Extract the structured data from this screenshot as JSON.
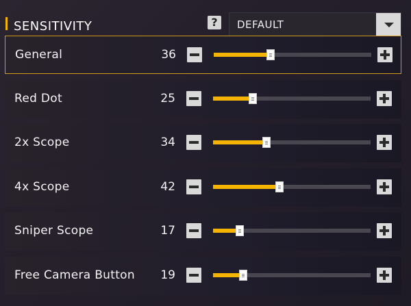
{
  "header": {
    "title": "SENSITIVITY",
    "help_glyph": "?",
    "preset": {
      "selected": "DEFAULT"
    }
  },
  "accent_color": "#f5b400",
  "slider_max": 100,
  "rows": [
    {
      "label": "General",
      "value": "36",
      "selected": true
    },
    {
      "label": "Red Dot",
      "value": "25",
      "selected": false
    },
    {
      "label": "2x Scope",
      "value": "34",
      "selected": false
    },
    {
      "label": "4x Scope",
      "value": "42",
      "selected": false
    },
    {
      "label": "Sniper Scope",
      "value": "17",
      "selected": false
    },
    {
      "label": "Free Camera Button",
      "value": "19",
      "selected": false
    }
  ]
}
